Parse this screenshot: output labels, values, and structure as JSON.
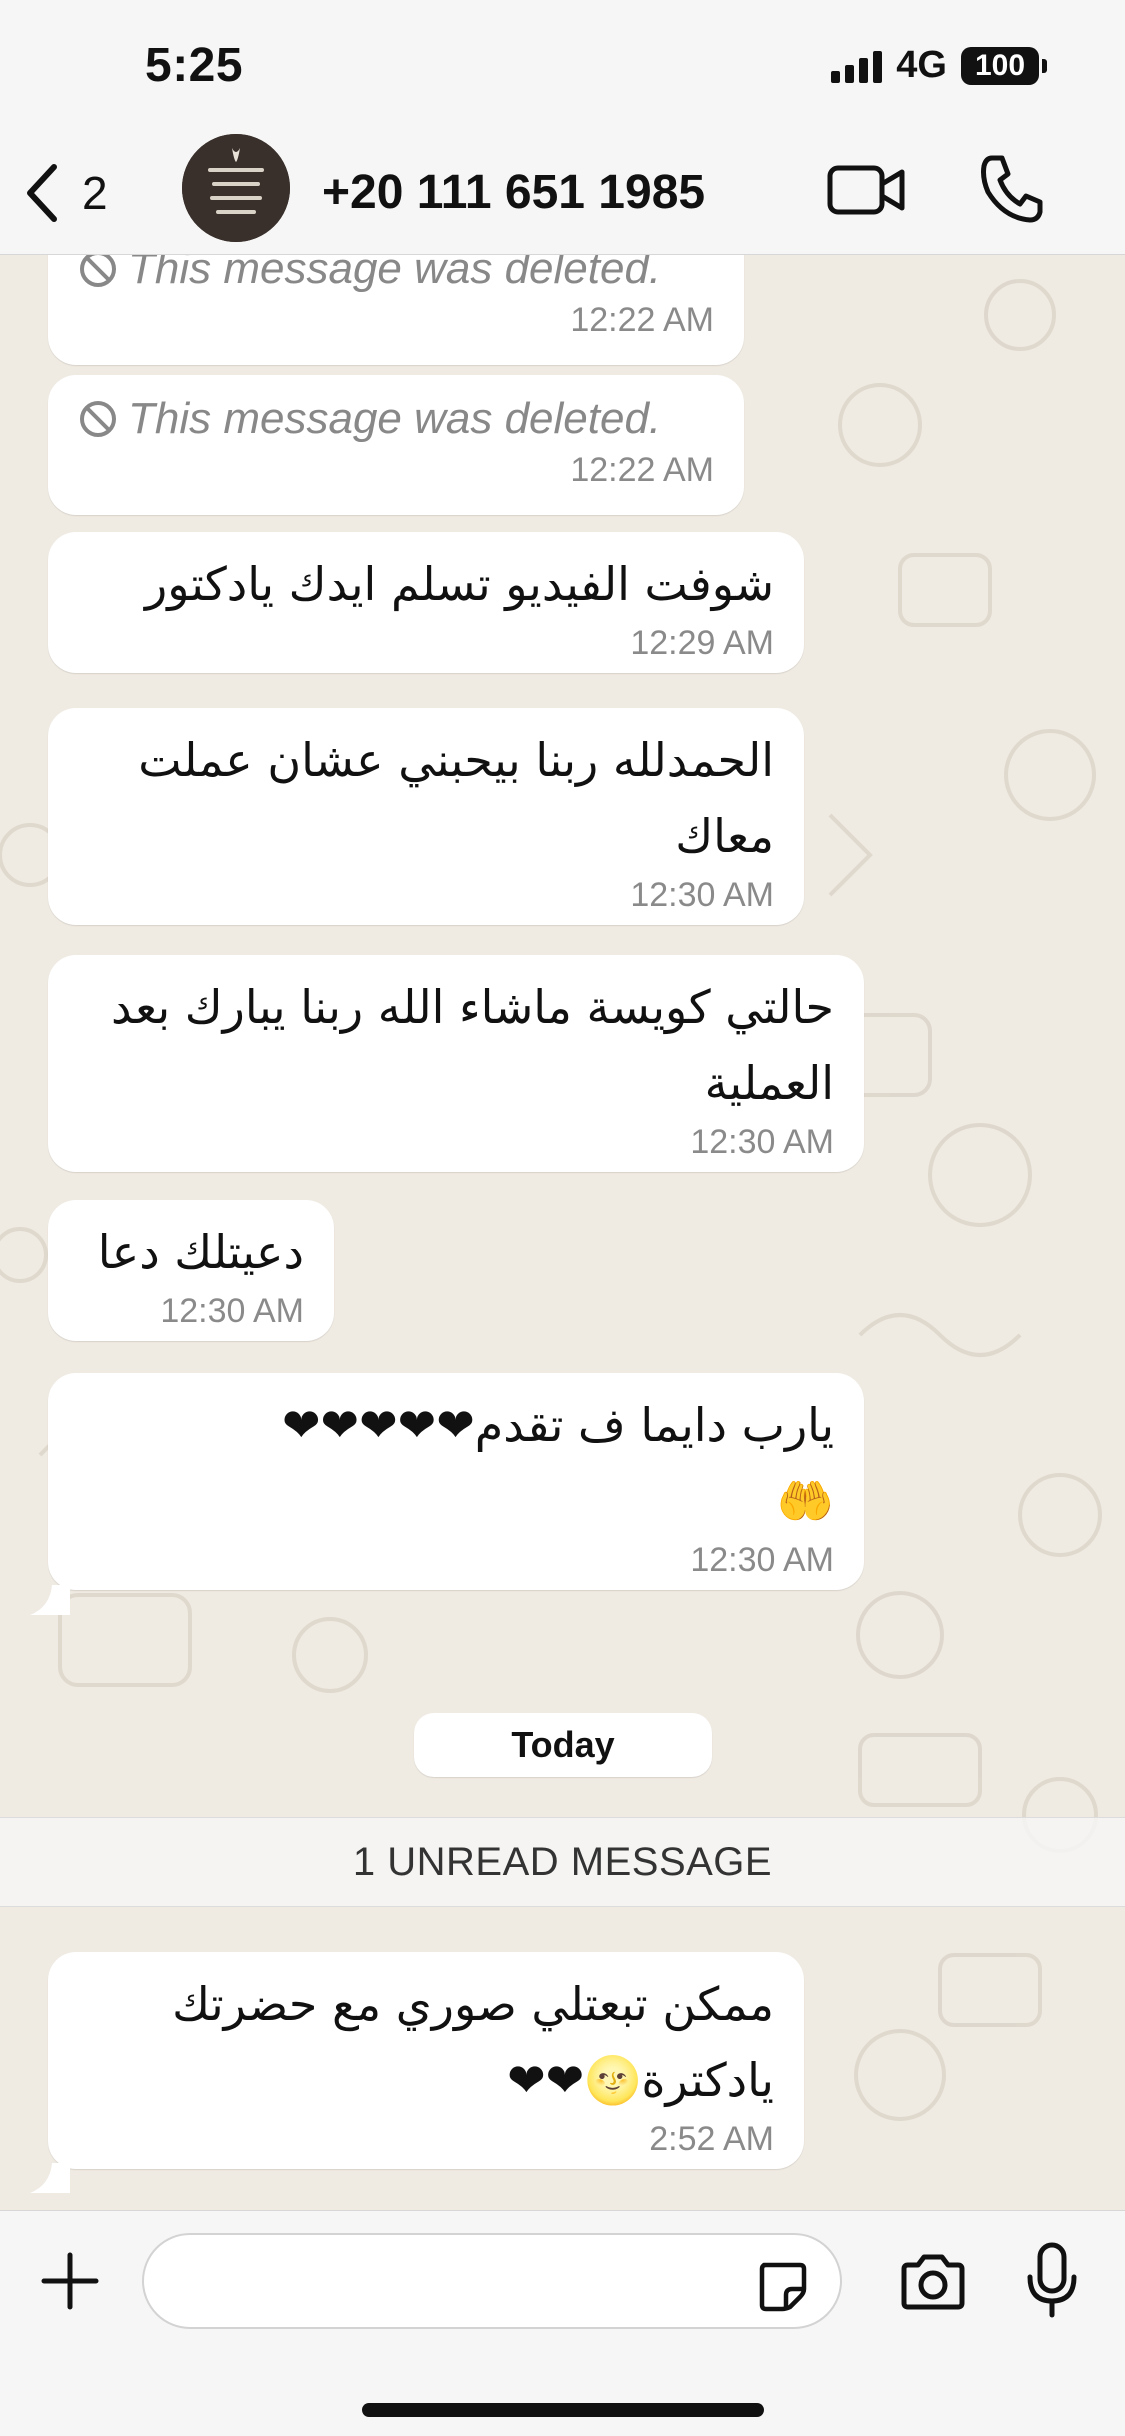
{
  "status_bar": {
    "time": "5:25",
    "network": "4G",
    "battery": "100"
  },
  "header": {
    "back_count": "2",
    "contact_name": "+20 111 651 1985",
    "avatar_icon": "profile-photo",
    "video_icon": "video-camera-icon",
    "call_icon": "phone-icon"
  },
  "messages": [
    {
      "text": "This message was deleted.",
      "time": "12:22 AM",
      "deleted": true
    },
    {
      "text": "This message was deleted.",
      "time": "12:22 AM",
      "deleted": true
    },
    {
      "text": "شوفت الفيديو تسلم ايدك يادكتور",
      "time": "12:29 AM"
    },
    {
      "text": "الحمدلله ربنا بيحبني عشان عملت معاك",
      "time": "12:30 AM"
    },
    {
      "text": "حالتي كويسة ماشاء الله ربنا يبارك بعد العملية",
      "time": "12:30 AM"
    },
    {
      "text": "دعيتلك دعا",
      "time": "12:30 AM"
    },
    {
      "text": "يارب دايما ف تقدم❤❤❤❤❤",
      "emoji": "🤲",
      "time": "12:30 AM"
    }
  ],
  "date_chip": "Today",
  "unread_banner": "1 UNREAD MESSAGE",
  "unread_messages": [
    {
      "text": "ممكن تبعتلي صوري مع حضرتك يادكترة🌝❤❤",
      "time": "2:52 AM"
    }
  ],
  "composer": {
    "placeholder": "",
    "value": ""
  },
  "colors": {
    "chat_background": "#efeae2",
    "bubble": "#ffffff",
    "bar": "#f6f6f6",
    "timestamp": "#8a8a8a"
  }
}
